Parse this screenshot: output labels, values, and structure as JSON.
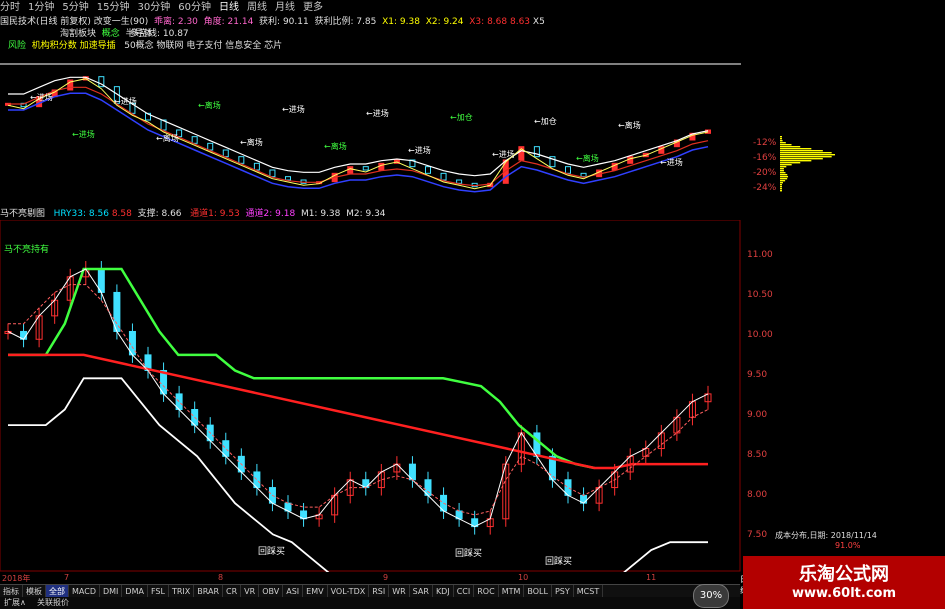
{
  "toolbar": {
    "items": [
      "分时",
      "1分钟",
      "5分钟",
      "15分钟",
      "30分钟",
      "60分钟",
      "日线",
      "周线",
      "月线",
      "更多"
    ],
    "active_index": 6
  },
  "info": {
    "stock_title": "国民技术(日线 前复权) 改变一生(90)",
    "rise_label": "乖离: 2.30",
    "angle_label": "角度: 21.14",
    "profit_label": "获利: 90.11",
    "ratio_label": "获利比例: 7.85",
    "x1_label": "X1: 9.38",
    "x2_label": "X2: 9.24",
    "x3_label": "X3:",
    "red1": "8.68",
    "red2": "8.63",
    "x5": "X5",
    "line2_a": "淘割板块",
    "line2_b": "概念",
    "line2_c": "半导体",
    "line2_d": "多空线: 10.87",
    "line3_a": "风险",
    "line3_b": "机构积分数 加速导插",
    "line3_c": "50概念 物联网 电子支付 信息安全 芯片"
  },
  "lower_info": {
    "title": "马不亮剔图",
    "hry": "HRY33: 8.56",
    "val_red": "8.58",
    "support": "支撑: 8.66",
    "ch1": "通道1: 9.53",
    "ch2": "通道2: 9.18",
    "m1": "M1: 9.38",
    "m2": "M2: 9.34"
  },
  "annotations": {
    "upper": [
      "进场",
      "进场",
      "进场",
      "离场",
      "离场",
      "离场",
      "进场",
      "离场",
      "进场",
      "进场",
      "加仓",
      "进场",
      "加仓",
      "离场",
      "离场",
      "进场"
    ],
    "lower_left": "马不亮持有",
    "bottom1": "回踩买",
    "bottom2": "回踩买",
    "bottom3": "回踩买"
  },
  "upper_axis": [
    "-12%",
    "-16%",
    "-20%",
    "-24%"
  ],
  "lower_axis": [
    "11.00",
    "10.50",
    "10.00",
    "9.50",
    "9.00",
    "8.50",
    "8.00",
    "7.50"
  ],
  "date_axis": {
    "labels": [
      "2018年",
      "7",
      "8",
      "9",
      "10",
      "11"
    ]
  },
  "cost_dist": {
    "title": "成本分布,日期: 2018/11/14",
    "percent": "91.0%"
  },
  "bottom_tabs": [
    "指标",
    "模板",
    "全部",
    "MACD",
    "DMI",
    "DMA",
    "FSL",
    "TRIX",
    "BRAR",
    "CR",
    "VR",
    "OBV",
    "ASI",
    "EMV",
    "VOL-TDX",
    "RSI",
    "WR",
    "SAR",
    "KDJ",
    "CCI",
    "ROC",
    "MTM",
    "BOLL",
    "PSY",
    "MCST"
  ],
  "status_bar": [
    "扩展∧",
    "关联报价"
  ],
  "badge": "30%",
  "side_flag": "日线",
  "watermark": {
    "line1": "乐淘公式网",
    "line2": "www.60lt.com"
  },
  "colors": {
    "up_candle": "#ff3030",
    "down_candle": "#40e0ff",
    "green_line": "#40ff40",
    "red_line": "#ff2020",
    "white_line": "#ffffff",
    "yellow_hist": "#ffff00",
    "panel_border": "#a02020"
  },
  "chart_data": [
    {
      "type": "line",
      "series": [
        {
          "values": [
            10.2,
            10.1,
            10.4,
            10.6,
            10.9,
            11.0,
            10.7,
            10.2,
            9.9,
            9.7,
            9.4,
            9.2,
            9.0,
            8.8,
            8.6,
            8.4,
            8.2,
            8.0,
            7.9,
            7.8,
            7.85,
            8.1,
            8.3,
            8.2,
            8.4,
            8.5,
            8.3,
            8.1,
            7.9,
            7.8,
            7.7,
            7.8,
            8.5,
            8.9,
            8.6,
            8.3,
            8.1,
            8.0,
            8.2,
            8.4,
            8.6,
            8.7,
            8.9,
            9.1,
            9.3,
            9.4
          ]
        },
        {
          "values": [
            10.3,
            10.3,
            10.5,
            10.7,
            10.8,
            10.8,
            10.6,
            10.3,
            10.0,
            9.7,
            9.5,
            9.3,
            9.1,
            8.9,
            8.7,
            8.5,
            8.3,
            8.1,
            8.0,
            7.95,
            7.95,
            8.1,
            8.2,
            8.2,
            8.3,
            8.35,
            8.3,
            8.15,
            8.0,
            7.9,
            7.85,
            7.9,
            8.3,
            8.6,
            8.5,
            8.35,
            8.2,
            8.1,
            8.2,
            8.3,
            8.45,
            8.6,
            8.75,
            8.9,
            9.1,
            9.2
          ]
        }
      ]
    },
    {
      "type": "line",
      "series": [
        {
          "values": [
            9.9,
            9.9,
            9.9,
            10.3,
            11.0,
            11.0,
            11.0,
            10.6,
            10.2,
            9.9,
            9.9,
            9.9,
            9.7,
            9.6,
            9.6,
            9.6,
            9.6,
            9.6,
            9.6,
            9.6,
            9.6,
            9.6,
            9.6,
            9.6,
            9.55,
            9.5,
            9.3,
            9.0,
            8.8,
            8.6,
            8.5,
            8.45,
            8.45,
            8.5,
            8.5,
            8.5,
            8.5,
            8.5
          ]
        },
        {
          "values": [
            10.0,
            10.0,
            10.0,
            10.2,
            10.6,
            10.6,
            10.6,
            10.3,
            10.0,
            9.8,
            9.6,
            9.3,
            9.0,
            8.8,
            8.6,
            8.5,
            8.3,
            8.1,
            7.9,
            7.8,
            7.7,
            7.7,
            7.7,
            7.7,
            7.7,
            7.7,
            7.7,
            7.7,
            7.7,
            7.7,
            7.7,
            7.8,
            8.0,
            8.2,
            8.4,
            8.5,
            8.5,
            8.5
          ]
        }
      ]
    }
  ]
}
